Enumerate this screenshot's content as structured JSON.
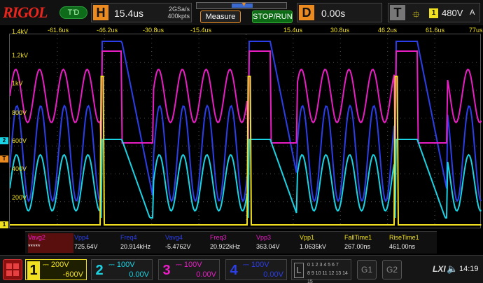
{
  "top": {
    "brand": "RIGOL",
    "trigger_status": "T'D",
    "horizontal": {
      "letter": "H",
      "timebase": "15.4us",
      "sample_rate": "2GSa/s",
      "memory_depth": "400kpts"
    },
    "measure_label": "Measure",
    "run_label": "STOP/RUN",
    "delay": {
      "letter": "D",
      "value": "0.00s"
    },
    "trigger": {
      "letter": "T",
      "source": "1",
      "level": "480V",
      "mode": "A"
    }
  },
  "time_ticks": [
    "-61.6us",
    "-46.2us",
    "-30.8us",
    "-15.4us",
    "15.4us",
    "30.8us",
    "46.2us",
    "61.6us",
    "77us"
  ],
  "volt_ticks": [
    "1.4kV",
    "1.2kV",
    "1kV",
    "800V",
    "600V",
    "400V",
    "200V"
  ],
  "markers": {
    "ch2": "2",
    "trig": "T",
    "ch1": "1"
  },
  "measurements": [
    {
      "name": "Vavg2",
      "value": "*****",
      "color": "#e81ec4"
    },
    {
      "name": "Vpp4",
      "value": "725.64V",
      "color": "#2b3ee8"
    },
    {
      "name": "Freq4",
      "value": "20.914kHz",
      "color": "#2b3ee8"
    },
    {
      "name": "Vavg4",
      "value": "-5.4762V",
      "color": "#2b3ee8"
    },
    {
      "name": "Freq3",
      "value": "20.922kHz",
      "color": "#e81ec4"
    },
    {
      "name": "Vpp3",
      "value": "363.04V",
      "color": "#e81ec4"
    },
    {
      "name": "Vpp1",
      "value": "1.0635kV",
      "color": "#f0e020"
    },
    {
      "name": "FallTime1",
      "value": "267.00ns",
      "color": "#f0e020"
    },
    {
      "name": "RiseTime1",
      "value": "461.00ns",
      "color": "#f0e020"
    }
  ],
  "channels": [
    {
      "num": "1",
      "scale": "200V",
      "offset": "-600V"
    },
    {
      "num": "2",
      "scale": "100V",
      "offset": "0.00V"
    },
    {
      "num": "3",
      "scale": "100V",
      "offset": "0.00V"
    },
    {
      "num": "4",
      "scale": "100V",
      "offset": "0.00V"
    }
  ],
  "logic": {
    "letter": "L",
    "bits_row1": "0 1 2 3 4 5 6 7",
    "bits_row2": "8 9 10 11 12 13 14 15"
  },
  "decode": [
    "G1",
    "G2"
  ],
  "lxi_label": "LXI",
  "clock": "14:19",
  "colors": {
    "ch1": "#f0e020",
    "ch2": "#1ad4e6",
    "ch3": "#e81ec4",
    "ch4": "#2b3ee8",
    "accent": "#ea8a1f"
  }
}
